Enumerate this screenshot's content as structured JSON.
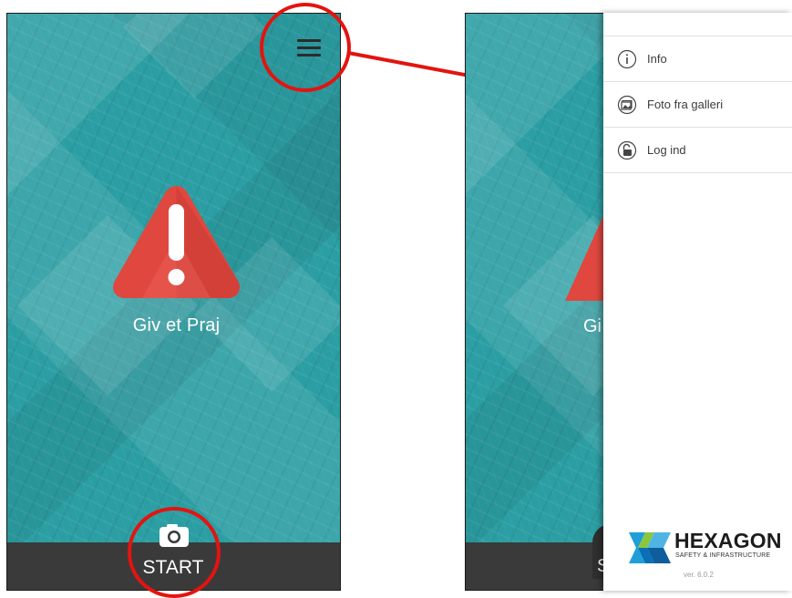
{
  "left_screen": {
    "app_title": "Giv et Praj",
    "start_label": "START",
    "menu_icon": "hamburger-menu-icon",
    "camera_icon": "camera-icon",
    "alert_icon": "warning-triangle-icon"
  },
  "right_screen": {
    "drawer": {
      "items": [
        {
          "label": "Info",
          "icon": "info-icon"
        },
        {
          "label": "Foto fra galleri",
          "icon": "gallery-icon"
        },
        {
          "label": "Log ind",
          "icon": "unlock-icon"
        }
      ]
    },
    "behind_text": "Gi",
    "behind_start": "S",
    "logo": {
      "name": "HEXAGON",
      "tagline": "SAFETY & INFRASTRUCTURE",
      "version": "ver. 6.0.2"
    }
  },
  "colors": {
    "map_teal": "#2b9ea3",
    "annotation_red": "#e3140f",
    "bottom_bar": "#3a3a3a",
    "warning_red": "#e0473f"
  }
}
